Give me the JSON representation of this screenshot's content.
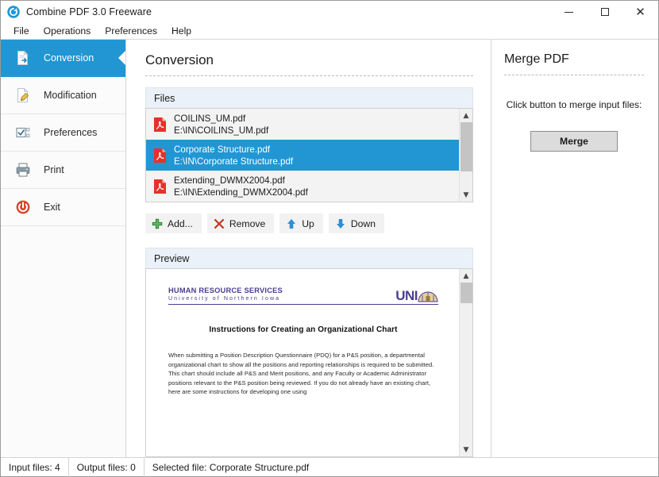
{
  "window": {
    "title": "Combine PDF 3.0 Freeware",
    "app_icon": "refresh-circle-icon",
    "controls": {
      "minimize": "minimize-icon",
      "maximize": "maximize-icon",
      "close": "close-icon"
    }
  },
  "menubar": {
    "items": [
      {
        "label": "File"
      },
      {
        "label": "Operations"
      },
      {
        "label": "Preferences"
      },
      {
        "label": "Help"
      }
    ]
  },
  "sidebar": {
    "items": [
      {
        "label": "Conversion",
        "icon": "document-convert-icon",
        "active": true
      },
      {
        "label": "Modification",
        "icon": "document-pencil-icon",
        "active": false
      },
      {
        "label": "Preferences",
        "icon": "checkbox-options-icon",
        "active": false
      },
      {
        "label": "Print",
        "icon": "printer-icon",
        "active": false
      },
      {
        "label": "Exit",
        "icon": "power-icon",
        "active": false
      }
    ]
  },
  "main": {
    "page_title": "Conversion",
    "files_group": {
      "label": "Files"
    },
    "files": [
      {
        "name": "COILINS_UM.pdf",
        "path": "E:\\IN\\COILINS_UM.pdf",
        "icon": "pdf-file-icon",
        "selected": false
      },
      {
        "name": "Corporate Structure.pdf",
        "path": "E:\\IN\\Corporate Structure.pdf",
        "icon": "pdf-file-icon",
        "selected": true
      },
      {
        "name": "Extending_DWMX2004.pdf",
        "path": "E:\\IN\\Extending_DWMX2004.pdf",
        "icon": "pdf-file-icon",
        "selected": false
      }
    ],
    "toolbar": [
      {
        "label": "Add...",
        "icon": "plus-icon"
      },
      {
        "label": "Remove",
        "icon": "x-mark-icon"
      },
      {
        "label": "Up",
        "icon": "arrow-up-icon"
      },
      {
        "label": "Down",
        "icon": "arrow-down-icon"
      }
    ],
    "preview_group": {
      "label": "Preview"
    },
    "preview_doc": {
      "org_title": "HUMAN RESOURCE SERVICES",
      "org_sub": "University of Northern Iowa",
      "logo_word": "UNI",
      "heading": "Instructions for Creating an Organizational Chart",
      "paragraph": "When submitting a Position Description Questionnaire (PDQ) for a P&S position, a departmental organizational chart to show all the positions and reporting relationships is required to be submitted. This chart should include all P&S and Merit positions, and any Faculty or Academic Administrator positions relevant to the P&S position being reviewed. If you do not already have an existing chart, here are some instructions for developing one using"
    }
  },
  "right_panel": {
    "title": "Merge PDF",
    "hint": "Click button to merge input files:",
    "merge_label": "Merge"
  },
  "statusbar": {
    "input_files": "Input files: 4",
    "output_files": "Output files: 0",
    "selected_file": "Selected file: Corporate Structure.pdf"
  },
  "colors": {
    "accent_blue": "#2196d3",
    "group_header_bg": "#eaf1f9",
    "pdf_red": "#e8302a",
    "uni_purple": "#4a3d8f",
    "add_green": "#4caf50",
    "remove_red": "#e0442e"
  }
}
